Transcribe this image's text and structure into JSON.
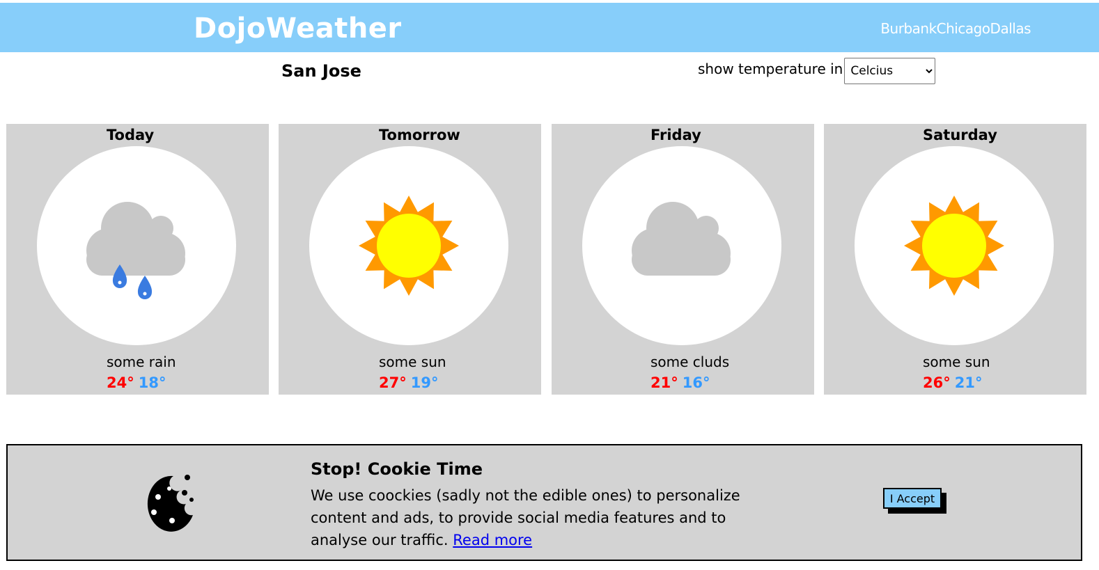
{
  "header": {
    "logo": "DojoWeather",
    "nav": [
      "Burbank",
      "Chicago",
      "Dallas"
    ]
  },
  "city": "San Jose",
  "unit": {
    "label": "show temperature in",
    "selected": "Celcius"
  },
  "forecast": [
    {
      "day": "Today",
      "icon": "rain-cloud-icon",
      "description": "some rain",
      "high": "24°",
      "low": "18°"
    },
    {
      "day": "Tomorrow",
      "icon": "sun-icon",
      "description": "some sun",
      "high": "27°",
      "low": "19°"
    },
    {
      "day": "Friday",
      "icon": "cloud-icon",
      "description": "some cluds",
      "high": "21°",
      "low": "16°"
    },
    {
      "day": "Saturday",
      "icon": "sun-icon",
      "description": "some sun",
      "high": "26°",
      "low": "21°"
    }
  ],
  "colors": {
    "header": "#87cefa",
    "card": "#d3d3d3",
    "high_temp": "#ff0000",
    "low_temp": "#3399ff",
    "sun_core": "#ffff00",
    "sun_rays": "#ff9900",
    "cloud": "#c8c8c8",
    "rain": "#3a7be0"
  },
  "cookie": {
    "icon": "cookie-icon",
    "title": "Stop! Cookie Time",
    "text": "We use coockies (sadly not the edible ones) to personalize content and ads, to provide social media features and to analyse our traffic.",
    "link": "Read more",
    "button": "I Accept"
  }
}
